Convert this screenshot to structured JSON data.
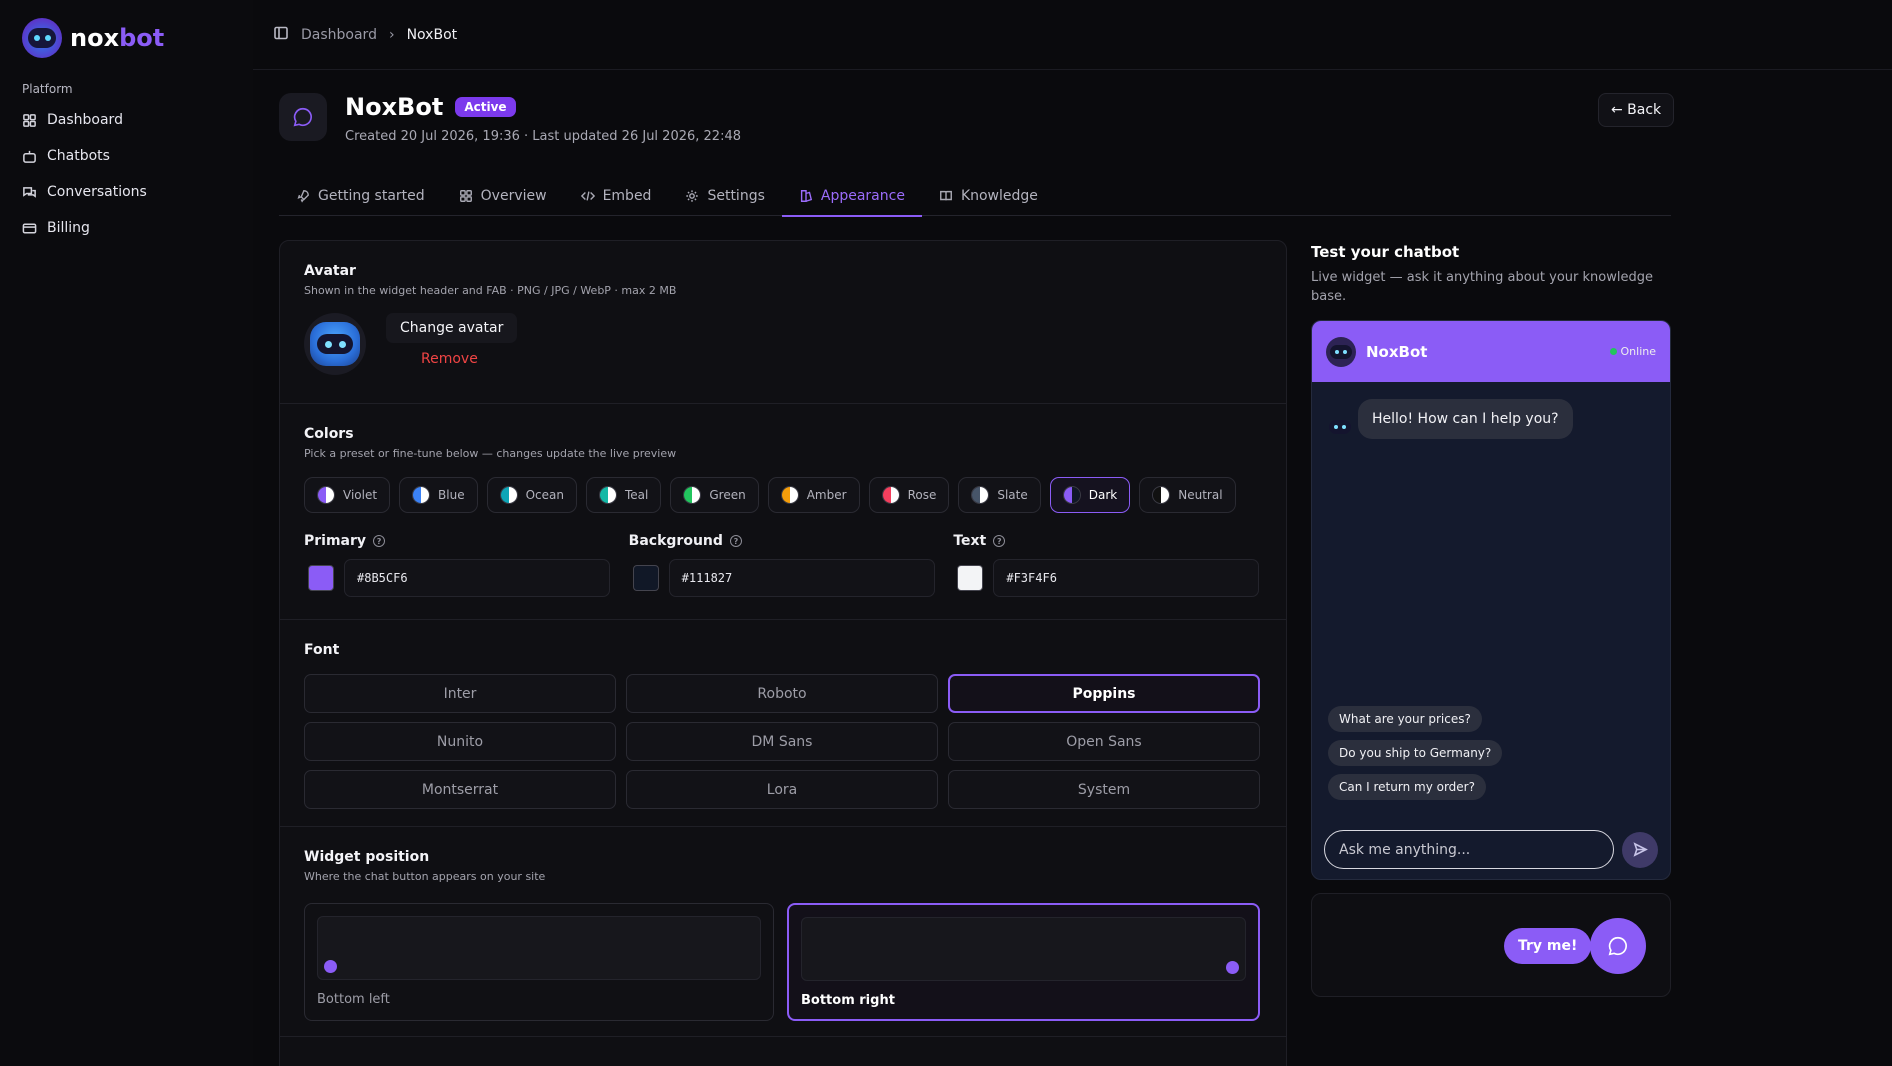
{
  "brand": {
    "name_part1": "nox",
    "name_part2": "bot"
  },
  "sidebar": {
    "section_label": "Platform",
    "items": [
      {
        "label": "Dashboard",
        "icon": "grid-icon"
      },
      {
        "label": "Chatbots",
        "icon": "bot-icon"
      },
      {
        "label": "Conversations",
        "icon": "chat-icon"
      },
      {
        "label": "Billing",
        "icon": "card-icon"
      }
    ]
  },
  "breadcrumb": {
    "parent": "Dashboard",
    "current": "NoxBot"
  },
  "header": {
    "title": "NoxBot",
    "status": "Active",
    "meta": "Created 20 Jul 2026, 19:36 · Last updated 26 Jul 2026, 22:48",
    "back_label": "← Back"
  },
  "tabs": [
    {
      "label": "Getting started",
      "icon": "rocket-icon"
    },
    {
      "label": "Overview",
      "icon": "grid-icon"
    },
    {
      "label": "Embed",
      "icon": "code-icon"
    },
    {
      "label": "Settings",
      "icon": "gear-icon"
    },
    {
      "label": "Appearance",
      "icon": "palette-icon",
      "active": true
    },
    {
      "label": "Knowledge",
      "icon": "book-icon"
    }
  ],
  "avatar": {
    "title": "Avatar",
    "subtitle": "Shown in the widget header and FAB · PNG / JPG / WebP · max 2 MB",
    "change_label": "Change avatar",
    "remove_label": "Remove"
  },
  "colors": {
    "title": "Colors",
    "subtitle": "Pick a preset or fine-tune below — changes update the live preview",
    "presets": [
      {
        "label": "Violet",
        "left": "#8b5cf6",
        "right": "#ffffff"
      },
      {
        "label": "Blue",
        "left": "#3b82f6",
        "right": "#ffffff"
      },
      {
        "label": "Ocean",
        "left": "#0ea5b7",
        "right": "#ffffff"
      },
      {
        "label": "Teal",
        "left": "#14b8a6",
        "right": "#ffffff"
      },
      {
        "label": "Green",
        "left": "#22c55e",
        "right": "#ffffff"
      },
      {
        "label": "Amber",
        "left": "#f59e0b",
        "right": "#ffffff"
      },
      {
        "label": "Rose",
        "left": "#f43f5e",
        "right": "#ffffff"
      },
      {
        "label": "Slate",
        "left": "#475569",
        "right": "#ffffff"
      },
      {
        "label": "Dark",
        "left": "#8b5cf6",
        "right": "#111827",
        "active": true
      },
      {
        "label": "Neutral",
        "left": "#111111",
        "right": "#ffffff"
      }
    ],
    "fields": [
      {
        "label": "Primary",
        "value": "#8B5CF6",
        "swatch": "#8b5cf6"
      },
      {
        "label": "Background",
        "value": "#111827",
        "swatch": "#111827"
      },
      {
        "label": "Text",
        "value": "#F3F4F6",
        "swatch": "#f3f4f6"
      }
    ]
  },
  "font": {
    "title": "Font",
    "options": [
      "Inter",
      "Roboto",
      "Poppins",
      "Nunito",
      "DM Sans",
      "Open Sans",
      "Montserrat",
      "Lora",
      "System"
    ],
    "selected": "Poppins"
  },
  "position": {
    "title": "Widget position",
    "subtitle": "Where the chat button appears on your site",
    "options": [
      {
        "label": "Bottom left",
        "side": "left"
      },
      {
        "label": "Bottom right",
        "side": "right",
        "active": true
      }
    ]
  },
  "test_panel": {
    "title": "Test your chatbot",
    "subtitle": "Live widget — ask it anything about your knowledge base.",
    "widget": {
      "name": "NoxBot",
      "status": "Online",
      "greeting": "Hello! How can I help you?",
      "suggestions": [
        "What are your prices?",
        "Do you ship to Germany?",
        "Can I return my order?"
      ],
      "input_placeholder": "Ask me anything..."
    },
    "fab_label": "Try me!"
  },
  "theme": {
    "accent": "#8b5cf6",
    "danger": "#ef4444",
    "widget_bg": "#141a2d"
  }
}
